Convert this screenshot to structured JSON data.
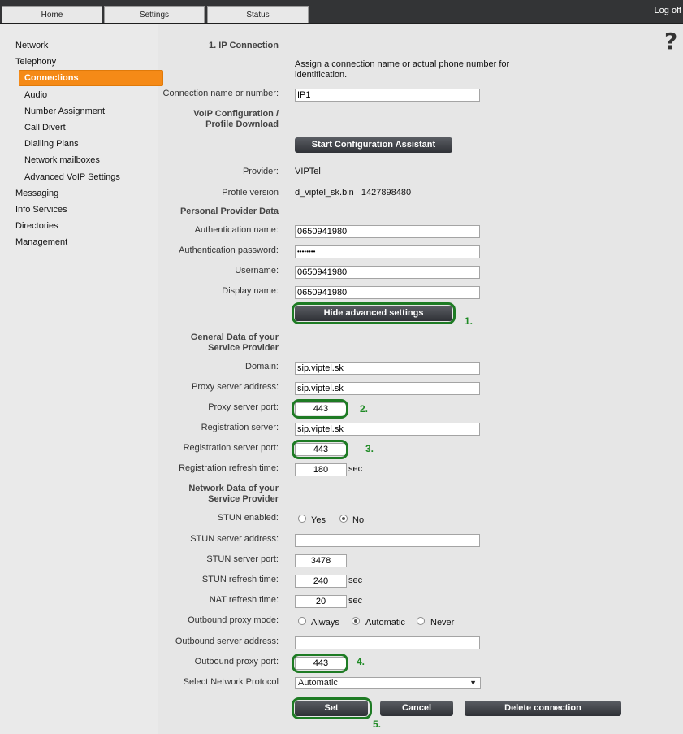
{
  "tabs": [
    "Home",
    "Settings",
    "Status"
  ],
  "logoff": "Log off",
  "help": "?",
  "sidebar": {
    "network": "Network",
    "telephony": "Telephony",
    "connections": "Connections",
    "audio": "Audio",
    "number_assignment": "Number Assignment",
    "call_divert": "Call Divert",
    "dialling_plans": "Dialling Plans",
    "network_mailboxes": "Network mailboxes",
    "advanced_voip": "Advanced VoIP Settings",
    "messaging": "Messaging",
    "info_services": "Info Services",
    "directories": "Directories",
    "management": "Management"
  },
  "form": {
    "section_ip": "1. IP Connection",
    "assign_hint_1": "Assign a connection name or actual phone number for",
    "assign_hint_2": "identification.",
    "conn_name_label": "Connection name or number:",
    "conn_name_value": "IP1",
    "voip_header_1": "VoIP Configuration /",
    "voip_header_2": "Profile Download",
    "start_assistant": "Start Configuration Assistant",
    "provider_label": "Provider:",
    "provider_value": "VIPTel",
    "profile_label": "Profile version",
    "profile_value": "d_viptel_sk.bin   1427898480",
    "personal_header": "Personal Provider Data",
    "auth_name_label": "Authentication name:",
    "auth_name_value": "0650941980",
    "auth_pass_label": "Authentication password:",
    "auth_pass_value": "••••••••",
    "username_label": "Username:",
    "username_value": "0650941980",
    "display_label": "Display name:",
    "display_value": "0650941980",
    "hide_advanced": "Hide advanced settings",
    "general_header_1": "General Data of your",
    "general_header_2": "Service Provider",
    "domain_label": "Domain:",
    "domain_value": "sip.viptel.sk",
    "proxy_addr_label": "Proxy server address:",
    "proxy_addr_value": "sip.viptel.sk",
    "proxy_port_label": "Proxy server port:",
    "proxy_port_value": "443",
    "reg_server_label": "Registration server:",
    "reg_server_value": "sip.viptel.sk",
    "reg_port_label": "Registration server port:",
    "reg_port_value": "443",
    "reg_refresh_label": "Registration refresh time:",
    "reg_refresh_value": "180",
    "sec": "sec",
    "network_header_1": "Network Data of your",
    "network_header_2": "Service Provider",
    "stun_enabled_label": "STUN enabled:",
    "yes": "Yes",
    "no": "No",
    "stun_addr_label": "STUN server address:",
    "stun_addr_value": "",
    "stun_port_label": "STUN server port:",
    "stun_port_value": "3478",
    "stun_refresh_label": "STUN refresh time:",
    "stun_refresh_value": "240",
    "nat_refresh_label": "NAT refresh time:",
    "nat_refresh_value": "20",
    "outbound_mode_label": "Outbound proxy mode:",
    "always": "Always",
    "automatic": "Automatic",
    "never": "Never",
    "outbound_addr_label": "Outbound server address:",
    "outbound_addr_value": "",
    "outbound_port_label": "Outbound proxy port:",
    "outbound_port_value": "443",
    "protocol_label": "Select Network Protocol",
    "protocol_value": "Automatic",
    "set": "Set",
    "cancel": "Cancel",
    "delete": "Delete connection"
  },
  "markers": [
    "1.",
    "2.",
    "3.",
    "4.",
    "5."
  ],
  "colors": {
    "accent": "#f58a17",
    "highlight": "#1e7b24",
    "topbar": "#333436"
  }
}
